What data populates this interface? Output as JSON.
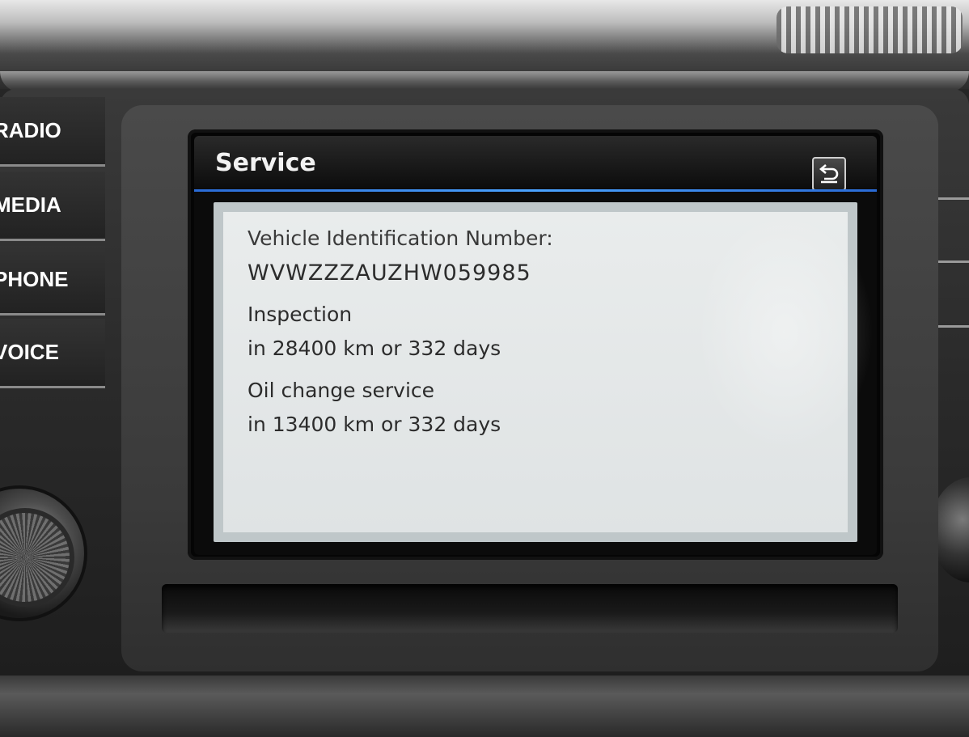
{
  "hardware_buttons": [
    {
      "label": "RADIO"
    },
    {
      "label": "MEDIA"
    },
    {
      "label": "PHONE"
    },
    {
      "label": "VOICE"
    }
  ],
  "screen": {
    "title": "Service",
    "back_icon": "back-arrow-icon",
    "vehicle_id_label": "Vehicle Identification Number:",
    "vehicle_id_value": "WVWZZZAUZHW059985",
    "inspection_label": "Inspection",
    "inspection_value": "in 28400 km or 332 days",
    "oil_label": "Oil change service",
    "oil_value": "in 13400 km or 332 days"
  },
  "colors": {
    "title_rule": "#2a6bd6",
    "panel_bg": "#e9ecec",
    "text": "#2c2c2c"
  }
}
